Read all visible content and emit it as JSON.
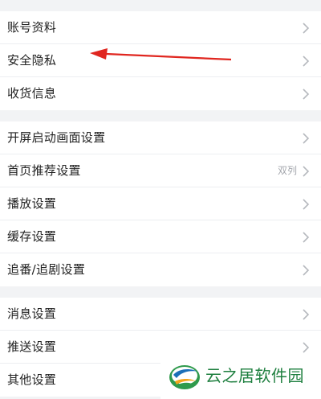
{
  "colors": {
    "page_bg": "#f2f3f5",
    "row_bg": "#ffffff",
    "label": "#222222",
    "value": "#a4a7ad",
    "chevron": "#b5b8bd",
    "annotation_arrow": "#e0261f",
    "watermark_text": "#1e7f3f"
  },
  "groups": [
    {
      "items": [
        {
          "label": "账号资料",
          "icon": "chevron-right-icon"
        },
        {
          "label": "安全隐私",
          "icon": "chevron-right-icon"
        },
        {
          "label": "收货信息",
          "icon": "chevron-right-icon"
        }
      ]
    },
    {
      "items": [
        {
          "label": "开屏启动画面设置",
          "icon": "chevron-right-icon"
        },
        {
          "label": "首页推荐设置",
          "value": "双列",
          "icon": "chevron-right-icon"
        },
        {
          "label": "播放设置",
          "icon": "chevron-right-icon"
        },
        {
          "label": "缓存设置",
          "icon": "chevron-right-icon"
        },
        {
          "label": "追番/追剧设置",
          "icon": "chevron-right-icon"
        }
      ]
    },
    {
      "items": [
        {
          "label": "消息设置",
          "icon": "chevron-right-icon"
        },
        {
          "label": "推送设置",
          "icon": "chevron-right-icon"
        },
        {
          "label": "其他设置",
          "icon": "chevron-right-icon"
        }
      ]
    }
  ],
  "annotation": {
    "icon": "red-arrow-icon"
  },
  "watermark": {
    "text": "云之居软件园",
    "icon": "yunzhiju-logo-icon"
  }
}
